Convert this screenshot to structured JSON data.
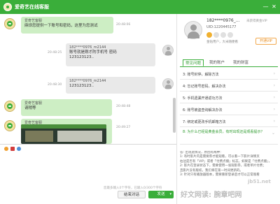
{
  "window": {
    "title": "爱奇艺在线客服",
    "minimize_label": "—",
    "close_label": "✕"
  },
  "chat": {
    "messages": [
      {
        "role": "agent",
        "sender": "爱奇艺客服",
        "lines": [
          "麻烦您提供一下账号和密码，这里为您测试"
        ],
        "time": "20:48:06"
      },
      {
        "role": "user",
        "sender": "182****0976_m2144",
        "lines": [
          "账号就是刚才的手机号 密码",
          "123123123.."
        ],
        "time": "20:48:25"
      },
      {
        "role": "user",
        "sender": "182****0976_m2144",
        "lines": [
          "123123123.."
        ],
        "time": "20:48:30"
      },
      {
        "role": "agent",
        "sender": "爱奇艺客服",
        "lines": [
          "请稍等"
        ],
        "time": "20:48:48"
      },
      {
        "role": "agent",
        "sender": "爱奇艺客服",
        "lines": [],
        "time": "20:49:27",
        "has_image": true
      }
    ]
  },
  "input": {
    "placeholder": "",
    "char_count_text": "您最多输入0个字符，已输入0/300个字符",
    "end_button": "结束对话",
    "send_button": "发送",
    "send_caret": "▾"
  },
  "profile": {
    "phone": "182****0976_...",
    "vip_status": "未获得黄金VIP",
    "uid": "UID:1220445177",
    "member_info": "金钻用户，大米随便看",
    "open_vip_button": "开通VIP"
  },
  "tabs": [
    {
      "label": "常见问题",
      "active": true
    },
    {
      "label": "我的账户",
      "active": false
    },
    {
      "label": "我的财富",
      "active": false
    }
  ],
  "faq": [
    {
      "label": "3: 账号封停，解除方法"
    },
    {
      "label": "4: 忘记账号密码，解决办法"
    },
    {
      "label": "5: 手机遗漏开通返功方法"
    },
    {
      "label": "6: 账号被盗查询解决办法"
    },
    {
      "label": "7: 绑定或更改手机邮箱方法"
    },
    {
      "label": "8: 为什么已经是黄金会员，有时出现还是观看提示？",
      "open": true
    }
  ],
  "faq_answer_lines": [
    "答: 出现此情况，原因有两种：",
    "1: 有时影片内是需要券才能观看，可以看一下影片详情页",
    "右边是否有「VIP」或者「付费点播」标志。如果是「付费点播」，",
    "2: 影片在登录状态下，需要使用一张观影券，或者单片付费；",
    "且影片没有版权，我们将在第一时间更新的。",
    "3: 针对只有播放器版本，需要重新登录后才可以正常观看"
  ],
  "watermarks": {
    "site": "jb51.net",
    "main": "好文网读: 腕章吧网"
  }
}
